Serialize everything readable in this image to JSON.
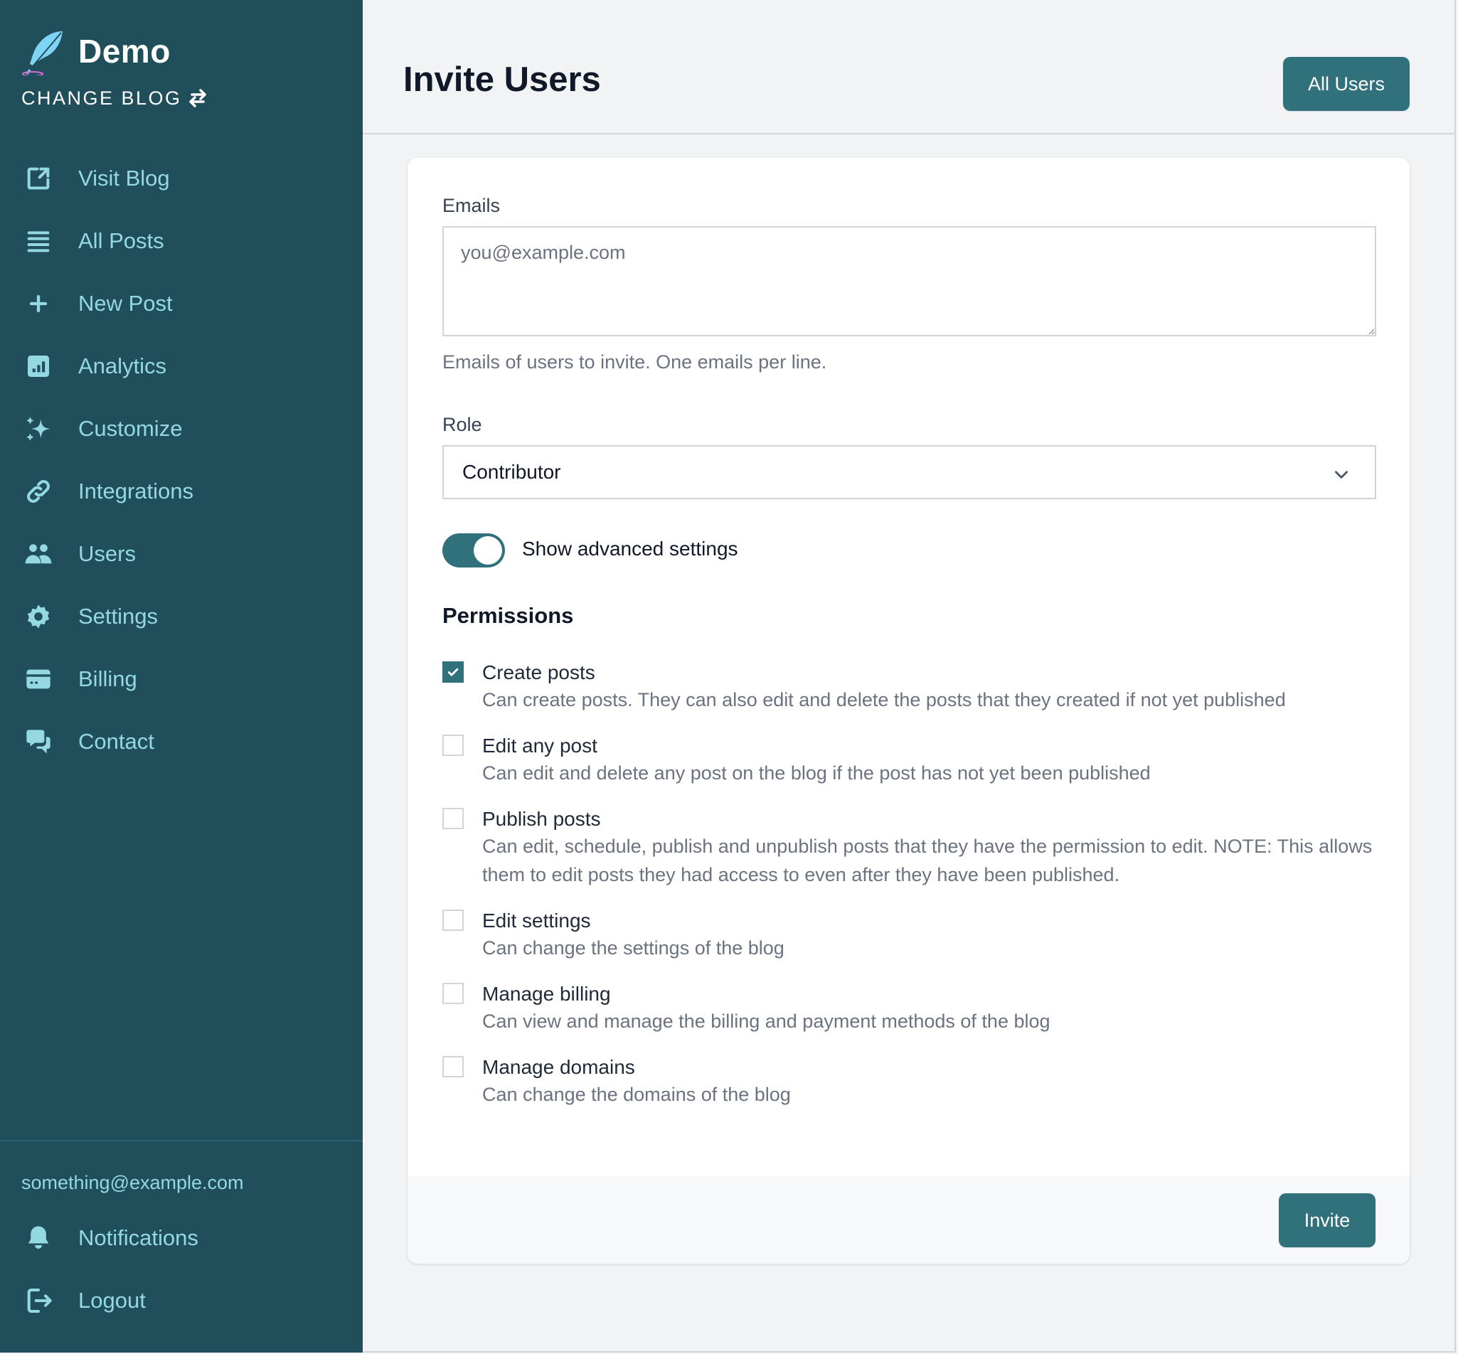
{
  "sidebar": {
    "brand_name": "Demo",
    "change_blog_label": "CHANGE BLOG",
    "nav_items": [
      {
        "label": "Visit Blog",
        "icon": "external-link-icon"
      },
      {
        "label": "All Posts",
        "icon": "list-icon"
      },
      {
        "label": "New Post",
        "icon": "plus-icon"
      },
      {
        "label": "Analytics",
        "icon": "chart-icon"
      },
      {
        "label": "Customize",
        "icon": "sparkles-icon"
      },
      {
        "label": "Integrations",
        "icon": "link-icon"
      },
      {
        "label": "Users",
        "icon": "users-icon"
      },
      {
        "label": "Settings",
        "icon": "gear-icon"
      },
      {
        "label": "Billing",
        "icon": "credit-card-icon"
      },
      {
        "label": "Contact",
        "icon": "chat-icon"
      }
    ],
    "user_email": "something@example.com",
    "bottom_items": [
      {
        "label": "Notifications",
        "icon": "bell-icon"
      },
      {
        "label": "Logout",
        "icon": "logout-icon"
      }
    ]
  },
  "header": {
    "title": "Invite Users",
    "all_users_label": "All Users"
  },
  "form": {
    "emails_label": "Emails",
    "emails_value": "",
    "emails_placeholder": "you@example.com",
    "emails_help": "Emails of users to invite. One emails per line.",
    "role_label": "Role",
    "role_value": "Contributor",
    "advanced_toggle_label": "Show advanced settings",
    "advanced_toggle_on": true,
    "permissions_heading": "Permissions",
    "permissions": [
      {
        "title": "Create posts",
        "desc": "Can create posts. They can also edit and delete the posts that they created if not yet published",
        "checked": true
      },
      {
        "title": "Edit any post",
        "desc": "Can edit and delete any post on the blog if the post has not yet been published",
        "checked": false
      },
      {
        "title": "Publish posts",
        "desc": "Can edit, schedule, publish and unpublish posts that they have the permission to edit. NOTE: This allows them to edit posts they had access to even after they have been published.",
        "checked": false
      },
      {
        "title": "Edit settings",
        "desc": "Can change the settings of the blog",
        "checked": false
      },
      {
        "title": "Manage billing",
        "desc": "Can view and manage the billing and payment methods of the blog",
        "checked": false
      },
      {
        "title": "Manage domains",
        "desc": "Can change the domains of the blog",
        "checked": false
      }
    ],
    "invite_label": "Invite"
  },
  "colors": {
    "sidebar_bg": "#214e5b",
    "sidebar_text": "#94d8e2",
    "accent": "#30717c",
    "page_bg": "#f2f3f5"
  }
}
